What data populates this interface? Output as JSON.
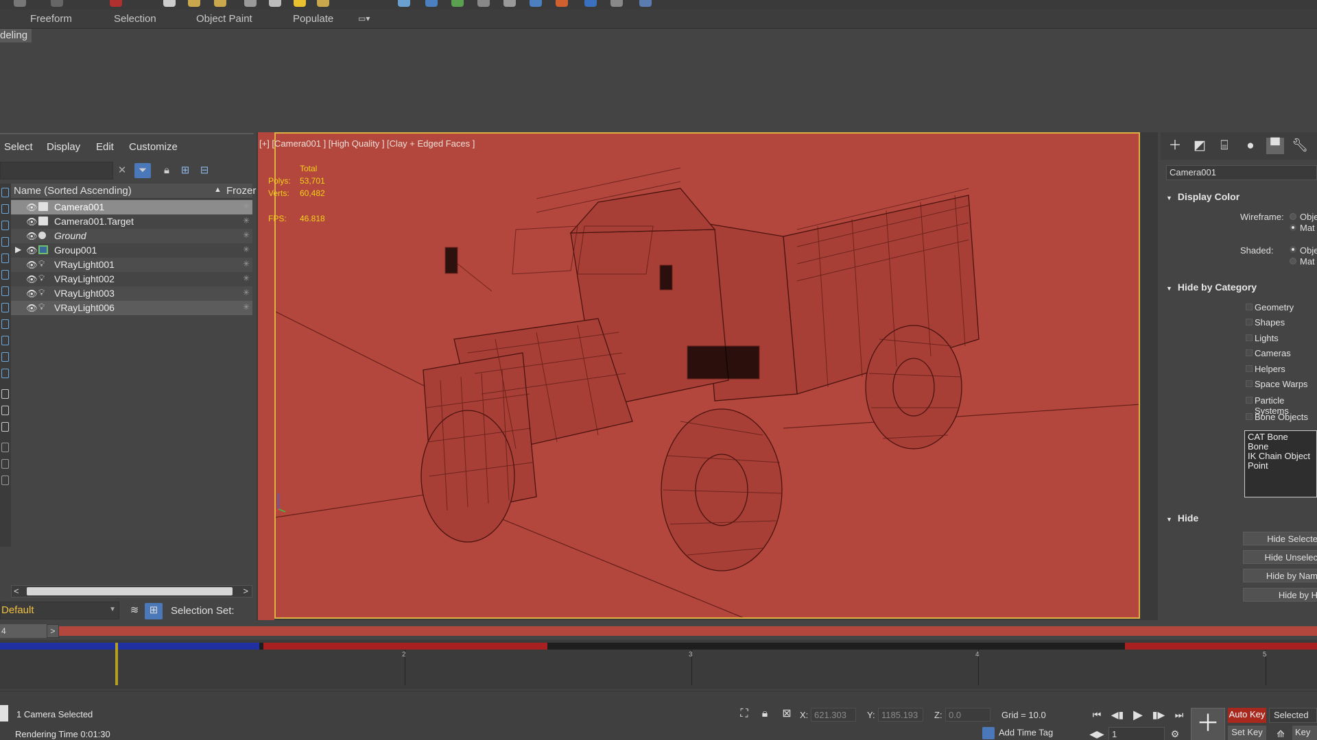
{
  "ribbon": {
    "tabs": [
      "Freeform",
      "Selection",
      "Object Paint",
      "Populate"
    ],
    "active_panel_label": "deling"
  },
  "explorer": {
    "menu": [
      "Select",
      "Display",
      "Edit",
      "Customize"
    ],
    "columns": {
      "name": "Name (Sorted Ascending)",
      "frozen": "Frozer"
    },
    "rows": [
      {
        "name": "Camera001",
        "type": "camera",
        "selected": true,
        "italic": false,
        "expandable": false
      },
      {
        "name": "Camera001.Target",
        "type": "camera",
        "selected": false,
        "italic": false,
        "expandable": false
      },
      {
        "name": "Ground",
        "type": "geometry",
        "selected": false,
        "italic": true,
        "expandable": false
      },
      {
        "name": "Group001",
        "type": "group",
        "selected": false,
        "italic": false,
        "expandable": true
      },
      {
        "name": "VRayLight001",
        "type": "light",
        "selected": false,
        "italic": false,
        "expandable": false
      },
      {
        "name": "VRayLight002",
        "type": "light",
        "selected": false,
        "italic": false,
        "expandable": false
      },
      {
        "name": "VRayLight003",
        "type": "light",
        "selected": false,
        "italic": false,
        "expandable": false
      },
      {
        "name": "VRayLight006",
        "type": "light",
        "selected": false,
        "italic": false,
        "expandable": false
      }
    ],
    "layer": "Default",
    "selection_set_label": "Selection Set:"
  },
  "viewport": {
    "label": "[+] [Camera001 ] [High Quality ] [Clay + Edged Faces ]",
    "stats": {
      "total_label": "Total",
      "polys_label": "Polys:",
      "polys": "53,701",
      "verts_label": "Verts:",
      "verts": "60,482",
      "fps_label": "FPS:",
      "fps": "46.818"
    },
    "background_color": "#b4473d",
    "border_color": "#e2b040"
  },
  "command_panel": {
    "object_name": "Camera001",
    "display_color": {
      "title": "Display Color",
      "wireframe_label": "Wireframe:",
      "shaded_label": "Shaded:",
      "option_object": "Obje",
      "option_material": "Mat"
    },
    "hide_by_category": {
      "title": "Hide by Category",
      "items": [
        "Geometry",
        "Shapes",
        "Lights",
        "Cameras",
        "Helpers",
        "Space Warps",
        "Particle Systems",
        "Bone Objects"
      ],
      "bone_list": [
        "CAT Bone",
        "Bone",
        "IK Chain Object",
        "Point"
      ]
    },
    "hide": {
      "title": "Hide",
      "buttons": [
        "Hide Selecte",
        "Hide Unselec",
        "Hide by Nam",
        "Hide by H"
      ]
    }
  },
  "time_slider": {
    "frame": "4",
    "next_label": ">",
    "ticks": [
      "2",
      "3",
      "4",
      "5"
    ]
  },
  "status": {
    "message": "1 Camera Selected",
    "render_time": "Rendering Time  0:01:30",
    "x_label": "X:",
    "x": "621.303",
    "y_label": "Y:",
    "y": "1185.193",
    "z_label": "Z:",
    "z": "0.0",
    "grid": "Grid = 10.0",
    "add_time_tag": "Add Time Tag",
    "current_frame": "1",
    "auto_key": "Auto Key",
    "key_mode": "Selected",
    "set_key": "Set Key",
    "key_filters": "Key"
  }
}
